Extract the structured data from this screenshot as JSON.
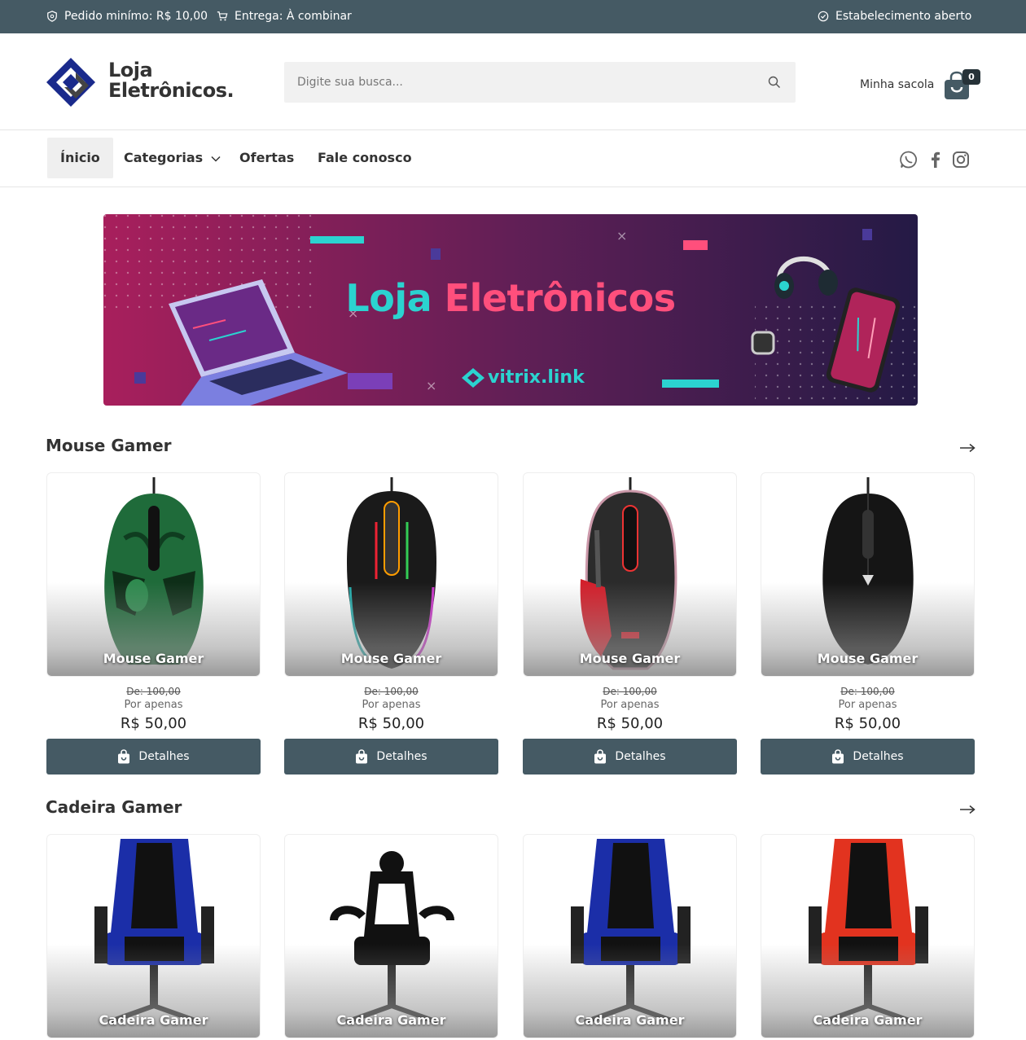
{
  "topbar": {
    "min_order": "Pedido minímo: R$ 10,00",
    "delivery": "Entrega: À combinar",
    "status": "Estabelecimento aberto"
  },
  "header": {
    "logo_line1": "Loja",
    "logo_line2": "Eletrônicos.",
    "search_placeholder": "Digite sua busca...",
    "bag_label": "Minha sacola",
    "bag_count": "0"
  },
  "nav": {
    "items": [
      "Ínicio",
      "Categorias",
      "Ofertas",
      "Fale conosco"
    ]
  },
  "banner": {
    "title_part1": "Loja",
    "title_part2": "Eletrônicos",
    "brand": "vitrix.link"
  },
  "sections": [
    {
      "title": "Mouse Gamer",
      "products": [
        {
          "name": "Mouse Gamer",
          "old_price": "De: 100,00",
          "por": "Por apenas",
          "price": "R$ 50,00",
          "button": "Detalhes"
        },
        {
          "name": "Mouse Gamer",
          "old_price": "De: 100,00",
          "por": "Por apenas",
          "price": "R$ 50,00",
          "button": "Detalhes"
        },
        {
          "name": "Mouse Gamer",
          "old_price": "De: 100,00",
          "por": "Por apenas",
          "price": "R$ 50,00",
          "button": "Detalhes"
        },
        {
          "name": "Mouse Gamer",
          "old_price": "De: 100,00",
          "por": "Por apenas",
          "price": "R$ 50,00",
          "button": "Detalhes"
        }
      ]
    },
    {
      "title": "Cadeira Gamer",
      "products": [
        {
          "name": "Cadeira Gamer"
        },
        {
          "name": "Cadeira Gamer"
        },
        {
          "name": "Cadeira Gamer"
        },
        {
          "name": "Cadeira Gamer"
        }
      ]
    }
  ],
  "colors": {
    "topbar": "#455a64",
    "button": "#455a64",
    "logo_blue": "#1a2a8c"
  }
}
